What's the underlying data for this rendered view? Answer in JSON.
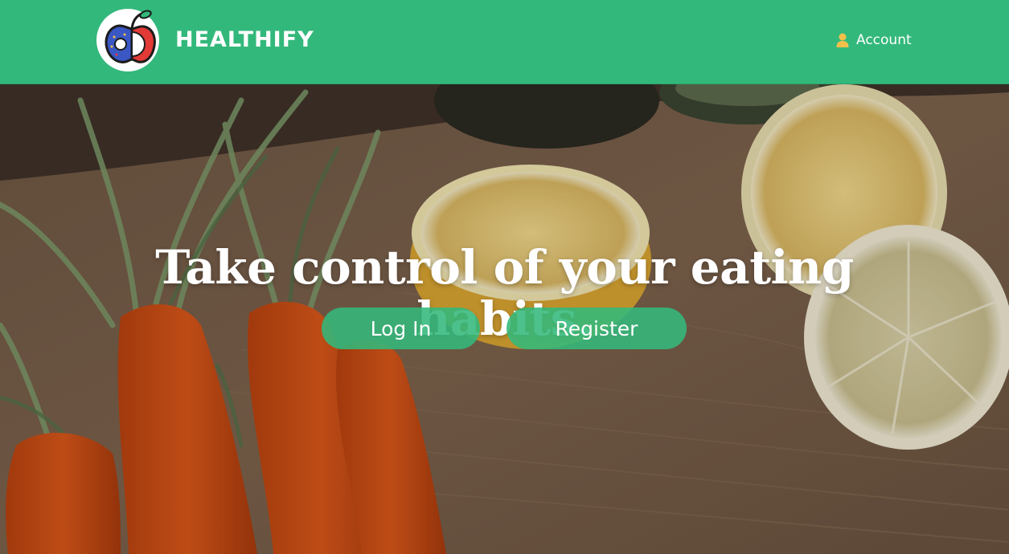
{
  "header": {
    "brand": "HEALTHIFY",
    "account_label": "Account",
    "accent_color": "#33b87b",
    "account_icon_color": "#f5c04a",
    "logo_icon": "apple-donut-logo-icon",
    "account_icon": "user-icon"
  },
  "hero": {
    "headline_line1": "Take control of your eating",
    "headline_line2": "habits.",
    "background": "photo-carrots-and-lemons-on-wooden-board",
    "buttons": {
      "login": "Log In",
      "register": "Register"
    }
  }
}
